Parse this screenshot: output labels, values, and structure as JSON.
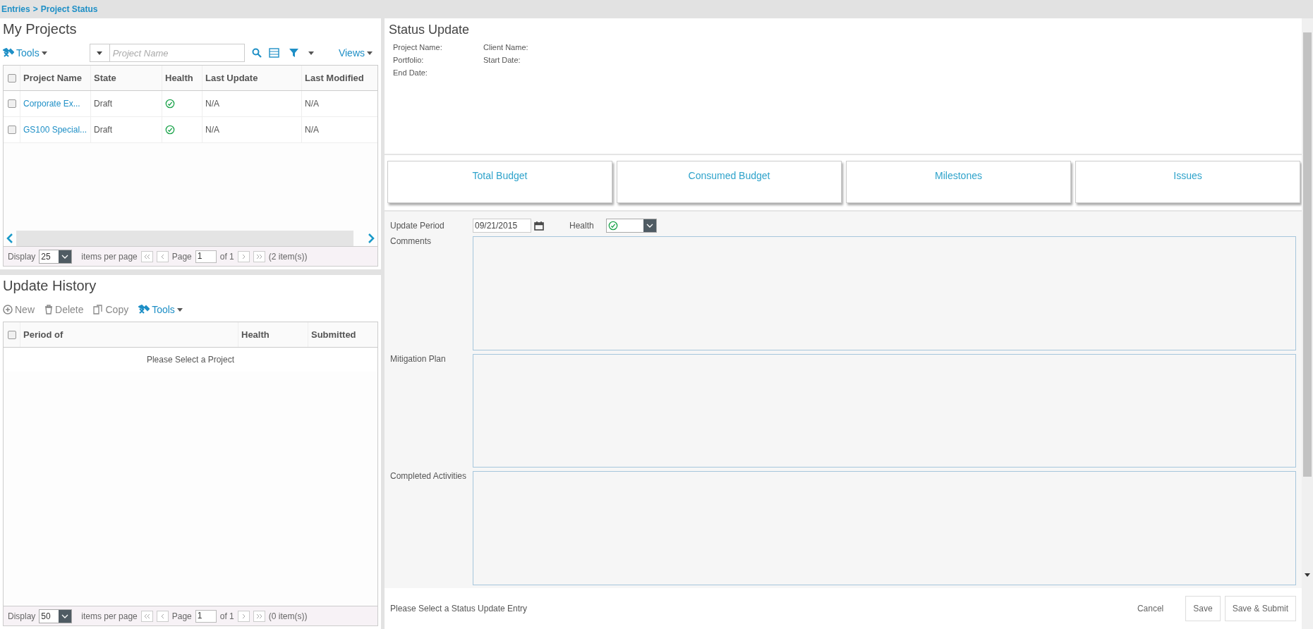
{
  "breadcrumb": {
    "items": [
      {
        "label": "Entries"
      },
      {
        "label": "Project Status"
      }
    ],
    "separator": ">"
  },
  "my_projects": {
    "title": "My Projects",
    "tools": "Tools",
    "search_placeholder": "Project Name",
    "views": "Views",
    "all_checked": false,
    "columns": [
      "Project Name",
      "State",
      "Health",
      "Last Update",
      "Last Modified"
    ],
    "rows": [
      {
        "checked": false,
        "project_name": "Corporate Ex...",
        "state": "Draft",
        "healthy": true,
        "last_update": "N/A",
        "last_modified": "N/A"
      },
      {
        "checked": false,
        "project_name": "GS100 Special...",
        "state": "Draft",
        "healthy": true,
        "last_update": "N/A",
        "last_modified": "N/A"
      }
    ],
    "pager": {
      "display_label": "Display",
      "display_value": "25",
      "items_per_page": "items per page",
      "page_label": "Page",
      "page": "1",
      "of": "of 1",
      "count": "(2 item(s))"
    }
  },
  "update_history": {
    "title": "Update History",
    "actions": [
      {
        "label": "New",
        "kind": "add"
      },
      {
        "label": "Delete",
        "kind": "delete"
      },
      {
        "label": "Copy",
        "kind": "copy"
      },
      {
        "label": "Tools",
        "kind": "tools"
      }
    ],
    "all_checked": false,
    "columns": [
      "Period of",
      "Health",
      "Submitted"
    ],
    "empty_message": "Please Select a Project",
    "pager": {
      "display_label": "Display",
      "display_value": "50",
      "items_per_page": "items per page",
      "page_label": "Page",
      "page": "1",
      "of": "of 1",
      "count": "(0 item(s))"
    }
  },
  "status_update": {
    "title": "Status Update",
    "info": [
      "Project Name:",
      "Client Name:",
      "Portfolio:",
      "Start Date:",
      "End Date:"
    ],
    "cards": [
      "Total Budget",
      "Consumed Budget",
      "Milestones",
      "Issues"
    ],
    "update_period": {
      "label": "Update Period",
      "value": "09/21/2015"
    },
    "health": {
      "label": "Health",
      "healthy": true
    },
    "text_areas": [
      {
        "label": "Comments"
      },
      {
        "label": "Mitigation Plan"
      },
      {
        "label": "Completed Activities"
      }
    ],
    "message": "Please Select a Status Update Entry",
    "buttons": [
      {
        "label": "Cancel",
        "kind": "link"
      },
      {
        "label": "Save",
        "kind": "outline"
      },
      {
        "label": "Save & Submit",
        "kind": "outline"
      }
    ]
  }
}
